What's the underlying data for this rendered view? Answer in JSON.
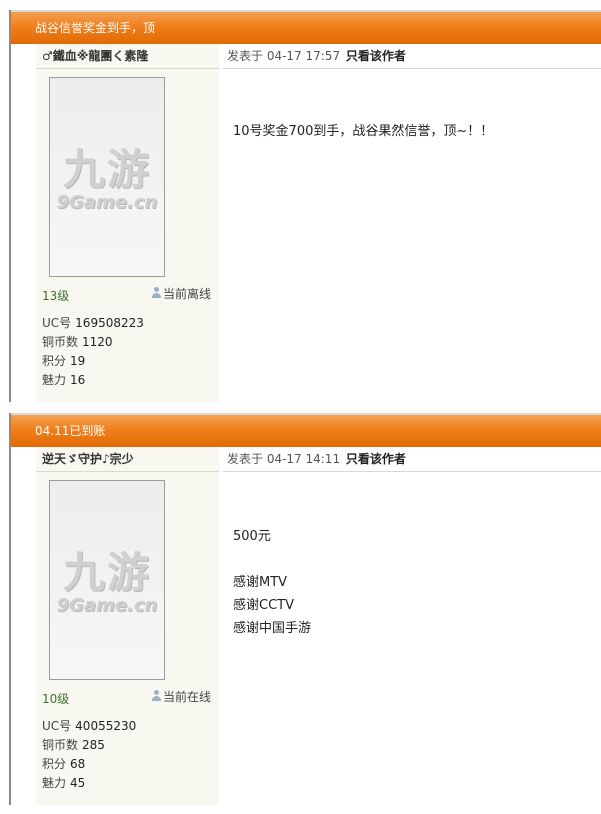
{
  "posts": [
    {
      "title": "战谷信誉奖金到手，顶",
      "username": "♂鐵血※龍團く素隆",
      "level": "13级",
      "status": "当前离线",
      "avatar_logo_cn": "九游",
      "avatar_logo_en": "9Game.cn",
      "stats": [
        {
          "label": "UC号",
          "value": "169508223"
        },
        {
          "label": "铜币数",
          "value": "1120"
        },
        {
          "label": "积分",
          "value": "19"
        },
        {
          "label": "魅力",
          "value": "16"
        }
      ],
      "posted_label": "发表于 04-17 17:57",
      "only_author": "只看该作者",
      "lines": [
        "10号奖金700到手，战谷果然信誉，顶~！！"
      ]
    },
    {
      "title": "04.11已到账",
      "username": "逆天ゞ守护♪宗少",
      "level": "10级",
      "status": "当前在线",
      "avatar_logo_cn": "九游",
      "avatar_logo_en": "9Game.cn",
      "stats": [
        {
          "label": "UC号",
          "value": "40055230"
        },
        {
          "label": "铜币数",
          "value": "285"
        },
        {
          "label": "积分",
          "value": "68"
        },
        {
          "label": "魅力",
          "value": "45"
        }
      ],
      "posted_label": "发表于 04-17 14:11",
      "only_author": "只看该作者",
      "lines": [
        "500元",
        "",
        "感谢MTV",
        "感谢CCTV",
        "感谢中国手游"
      ]
    }
  ]
}
